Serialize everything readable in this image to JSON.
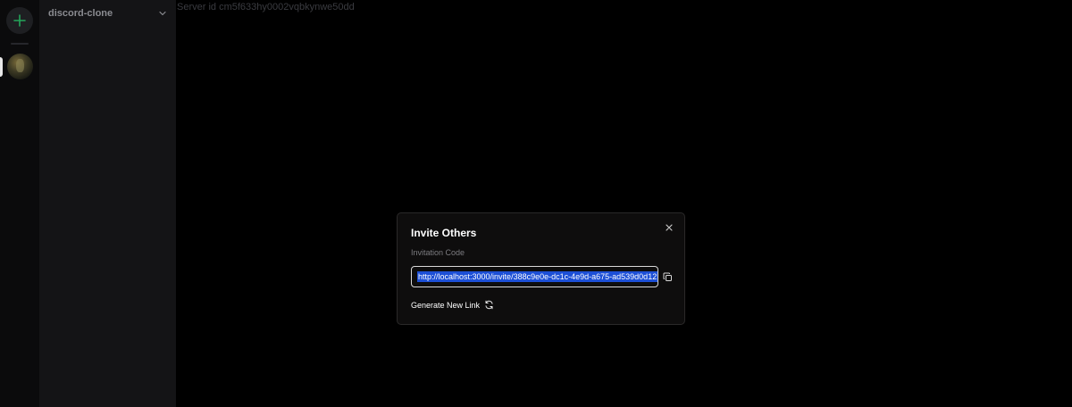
{
  "server_rail": {
    "add_icon": "plus-icon",
    "accent": "#23a55a"
  },
  "sidebar": {
    "server_name": "discord-clone",
    "chevron_icon": "chevron-down-icon"
  },
  "main": {
    "server_id_text": "Server id cm5f633hy0002vqbkynwe50dd"
  },
  "invite_modal": {
    "title": "Invite Others",
    "label": "Invitation Code",
    "invite_url": "http://localhost:3000/invite/388c9e0e-dc1c-4e9d-a675-ad539d0d12",
    "generate_label": "Generate New Link",
    "copy_icon": "copy-icon",
    "refresh_icon": "refresh-icon",
    "close_icon": "close-icon"
  }
}
